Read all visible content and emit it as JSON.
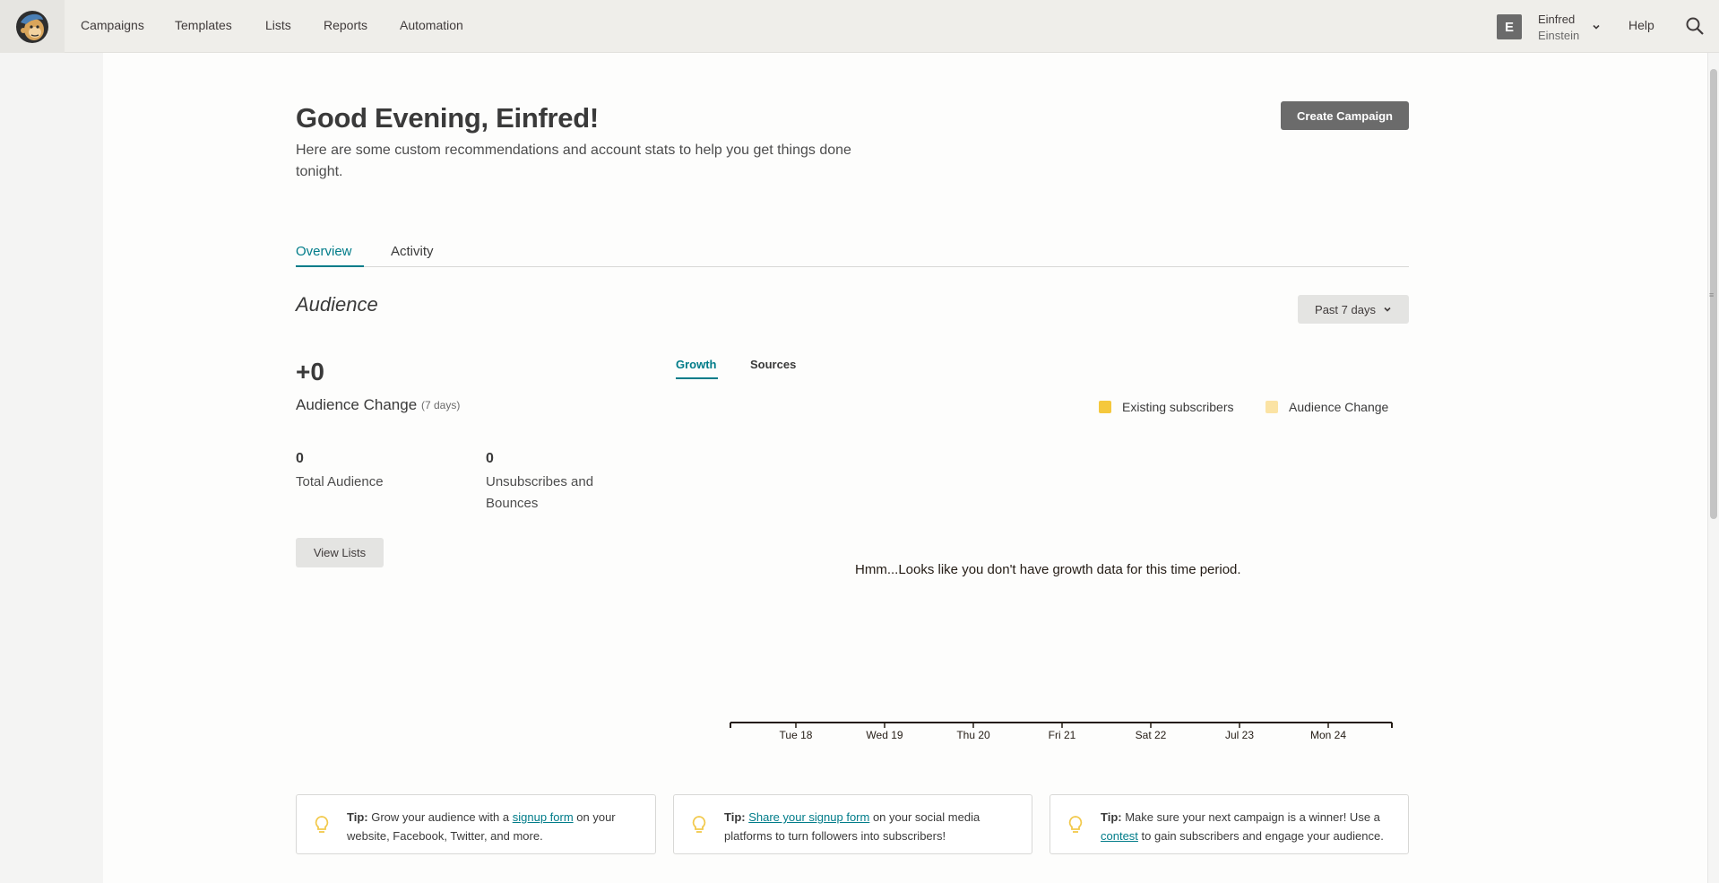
{
  "nav": {
    "items": [
      "Campaigns",
      "Templates",
      "Lists",
      "Reports",
      "Automation"
    ],
    "account": {
      "initial": "E",
      "first_name": "Einfred",
      "last_name": "Einstein"
    },
    "help": "Help"
  },
  "header": {
    "greeting": "Good Evening, Einfred!",
    "subtext": "Here are some custom recommendations and account stats to help you get things done tonight.",
    "create_button": "Create Campaign"
  },
  "tabs": [
    "Overview",
    "Activity"
  ],
  "audience": {
    "title": "Audience",
    "period": "Past 7 days",
    "change_value": "+0",
    "change_label": "Audience Change",
    "change_days": "(7 days)",
    "total_value": "0",
    "total_label": "Total Audience",
    "unsub_value": "0",
    "unsub_label": "Unsubscribes and Bounces",
    "view_lists": "View Lists"
  },
  "chart": {
    "subtabs": [
      "Growth",
      "Sources"
    ],
    "legend": [
      {
        "label": "Existing subscribers",
        "color": "#f5c83d"
      },
      {
        "label": "Audience Change",
        "color": "#fbe3a4"
      }
    ],
    "empty_message": "Hmm...Looks like you don't have growth data for this time period.",
    "x_ticks": [
      "Tue 18",
      "Wed 19",
      "Thu 20",
      "Fri 21",
      "Sat 22",
      "Jul 23",
      "Mon 24"
    ]
  },
  "tips": [
    {
      "prefix": "Tip:",
      "before": " Grow your audience with a ",
      "link": "signup form",
      "after": " on your website, Facebook, Twitter, and more."
    },
    {
      "prefix": "Tip:",
      "before": " ",
      "link": "Share your signup form",
      "after": " on your social media platforms to turn followers into subscribers!"
    },
    {
      "prefix": "Tip:",
      "before": " Make sure your next campaign is a winner! Use a ",
      "link": "contest",
      "after": " to gain subscribers and engage your audience."
    }
  ],
  "colors": {
    "accent": "#007c89",
    "button_dark": "#6b6b6b"
  }
}
